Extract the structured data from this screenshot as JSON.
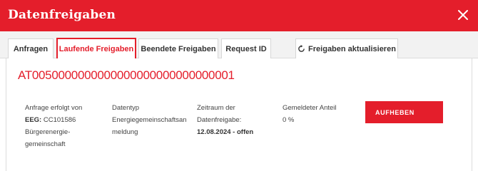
{
  "dialog": {
    "title": "Datenfreigaben",
    "close_icon": "close-icon"
  },
  "tabs": [
    {
      "label": "Anfragen",
      "active": false
    },
    {
      "label": "Laufende Freigaben",
      "active": true
    },
    {
      "label": "Beendete Freigaben",
      "active": false
    },
    {
      "label": "Request ID",
      "active": false
    }
  ],
  "refresh_tab": {
    "label": "Freigaben aktualisieren",
    "icon": "refresh-icon"
  },
  "share": {
    "metering_point": "AT0050000000000000000000000000001",
    "request_label": "Anfrage erfolgt von",
    "eeg_label": "EEG:",
    "eeg_id": "CC101586",
    "eeg_name": "Bürgerenergie-gemeinschaft",
    "datatype_label": "Datentyp",
    "datatype_value": "Energiegemeinschaftsanmeldung",
    "period_label": "Zeitraum der Datenfreigabe:",
    "period_value": "12.08.2024 - offen",
    "share_label": "Gemeldeter Anteil",
    "share_value": "0 %",
    "action_label": "AUFHEBEN"
  },
  "colors": {
    "accent": "#e41e2b"
  }
}
